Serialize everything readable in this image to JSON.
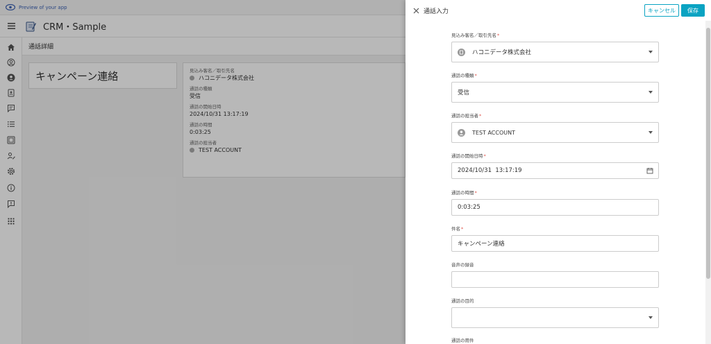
{
  "preview": {
    "text": "Preview of your app"
  },
  "header": {
    "app_title": "CRM・Sample"
  },
  "sidebar": {
    "icons": [
      "home-icon",
      "contacts-icon",
      "account-circle-icon",
      "contact-card-icon",
      "chat-icon",
      "list-icon",
      "image-icon",
      "person-edit-icon",
      "settings-icon",
      "info-icon",
      "feedback-icon",
      "apps-grid-icon"
    ]
  },
  "page": {
    "title": "通話詳細",
    "record_title": "キャンペーン連絡",
    "details": [
      {
        "label": "見込み客名／取引先名",
        "value": "ハコニデータ株式会社"
      },
      {
        "label": "通話の種類",
        "value": "受信"
      },
      {
        "label": "通話の開始日時",
        "value": "2024/10/31 13:17:19"
      },
      {
        "label": "通話の時間",
        "value": "0:03:25"
      },
      {
        "label": "通話の担当者",
        "value": "TEST ACCOUNT"
      }
    ]
  },
  "drawer": {
    "title": "通話入力",
    "cancel_label": "キャンセル",
    "save_label": "保存",
    "required_mark": "*",
    "fields": [
      {
        "label": "見込み客名／取引先名",
        "value": "ハコニデータ株式会社"
      },
      {
        "label": "通話の種類",
        "value": "受信"
      },
      {
        "label": "通話の担当者",
        "value": "TEST ACCOUNT"
      },
      {
        "label": "通話の開始日時",
        "value": "2024/10/31  13:17:19"
      },
      {
        "label": "通話の時間",
        "value": "0:03:25"
      },
      {
        "label": "件名",
        "value": "キャンペーン連絡"
      },
      {
        "label": "音声の録音",
        "value": ""
      },
      {
        "label": "通話の目的",
        "value": ""
      },
      {
        "label": "通話の用件",
        "value": ""
      }
    ]
  },
  "colors": {
    "accent": "#0aa3c2",
    "required": "#e0534a"
  }
}
